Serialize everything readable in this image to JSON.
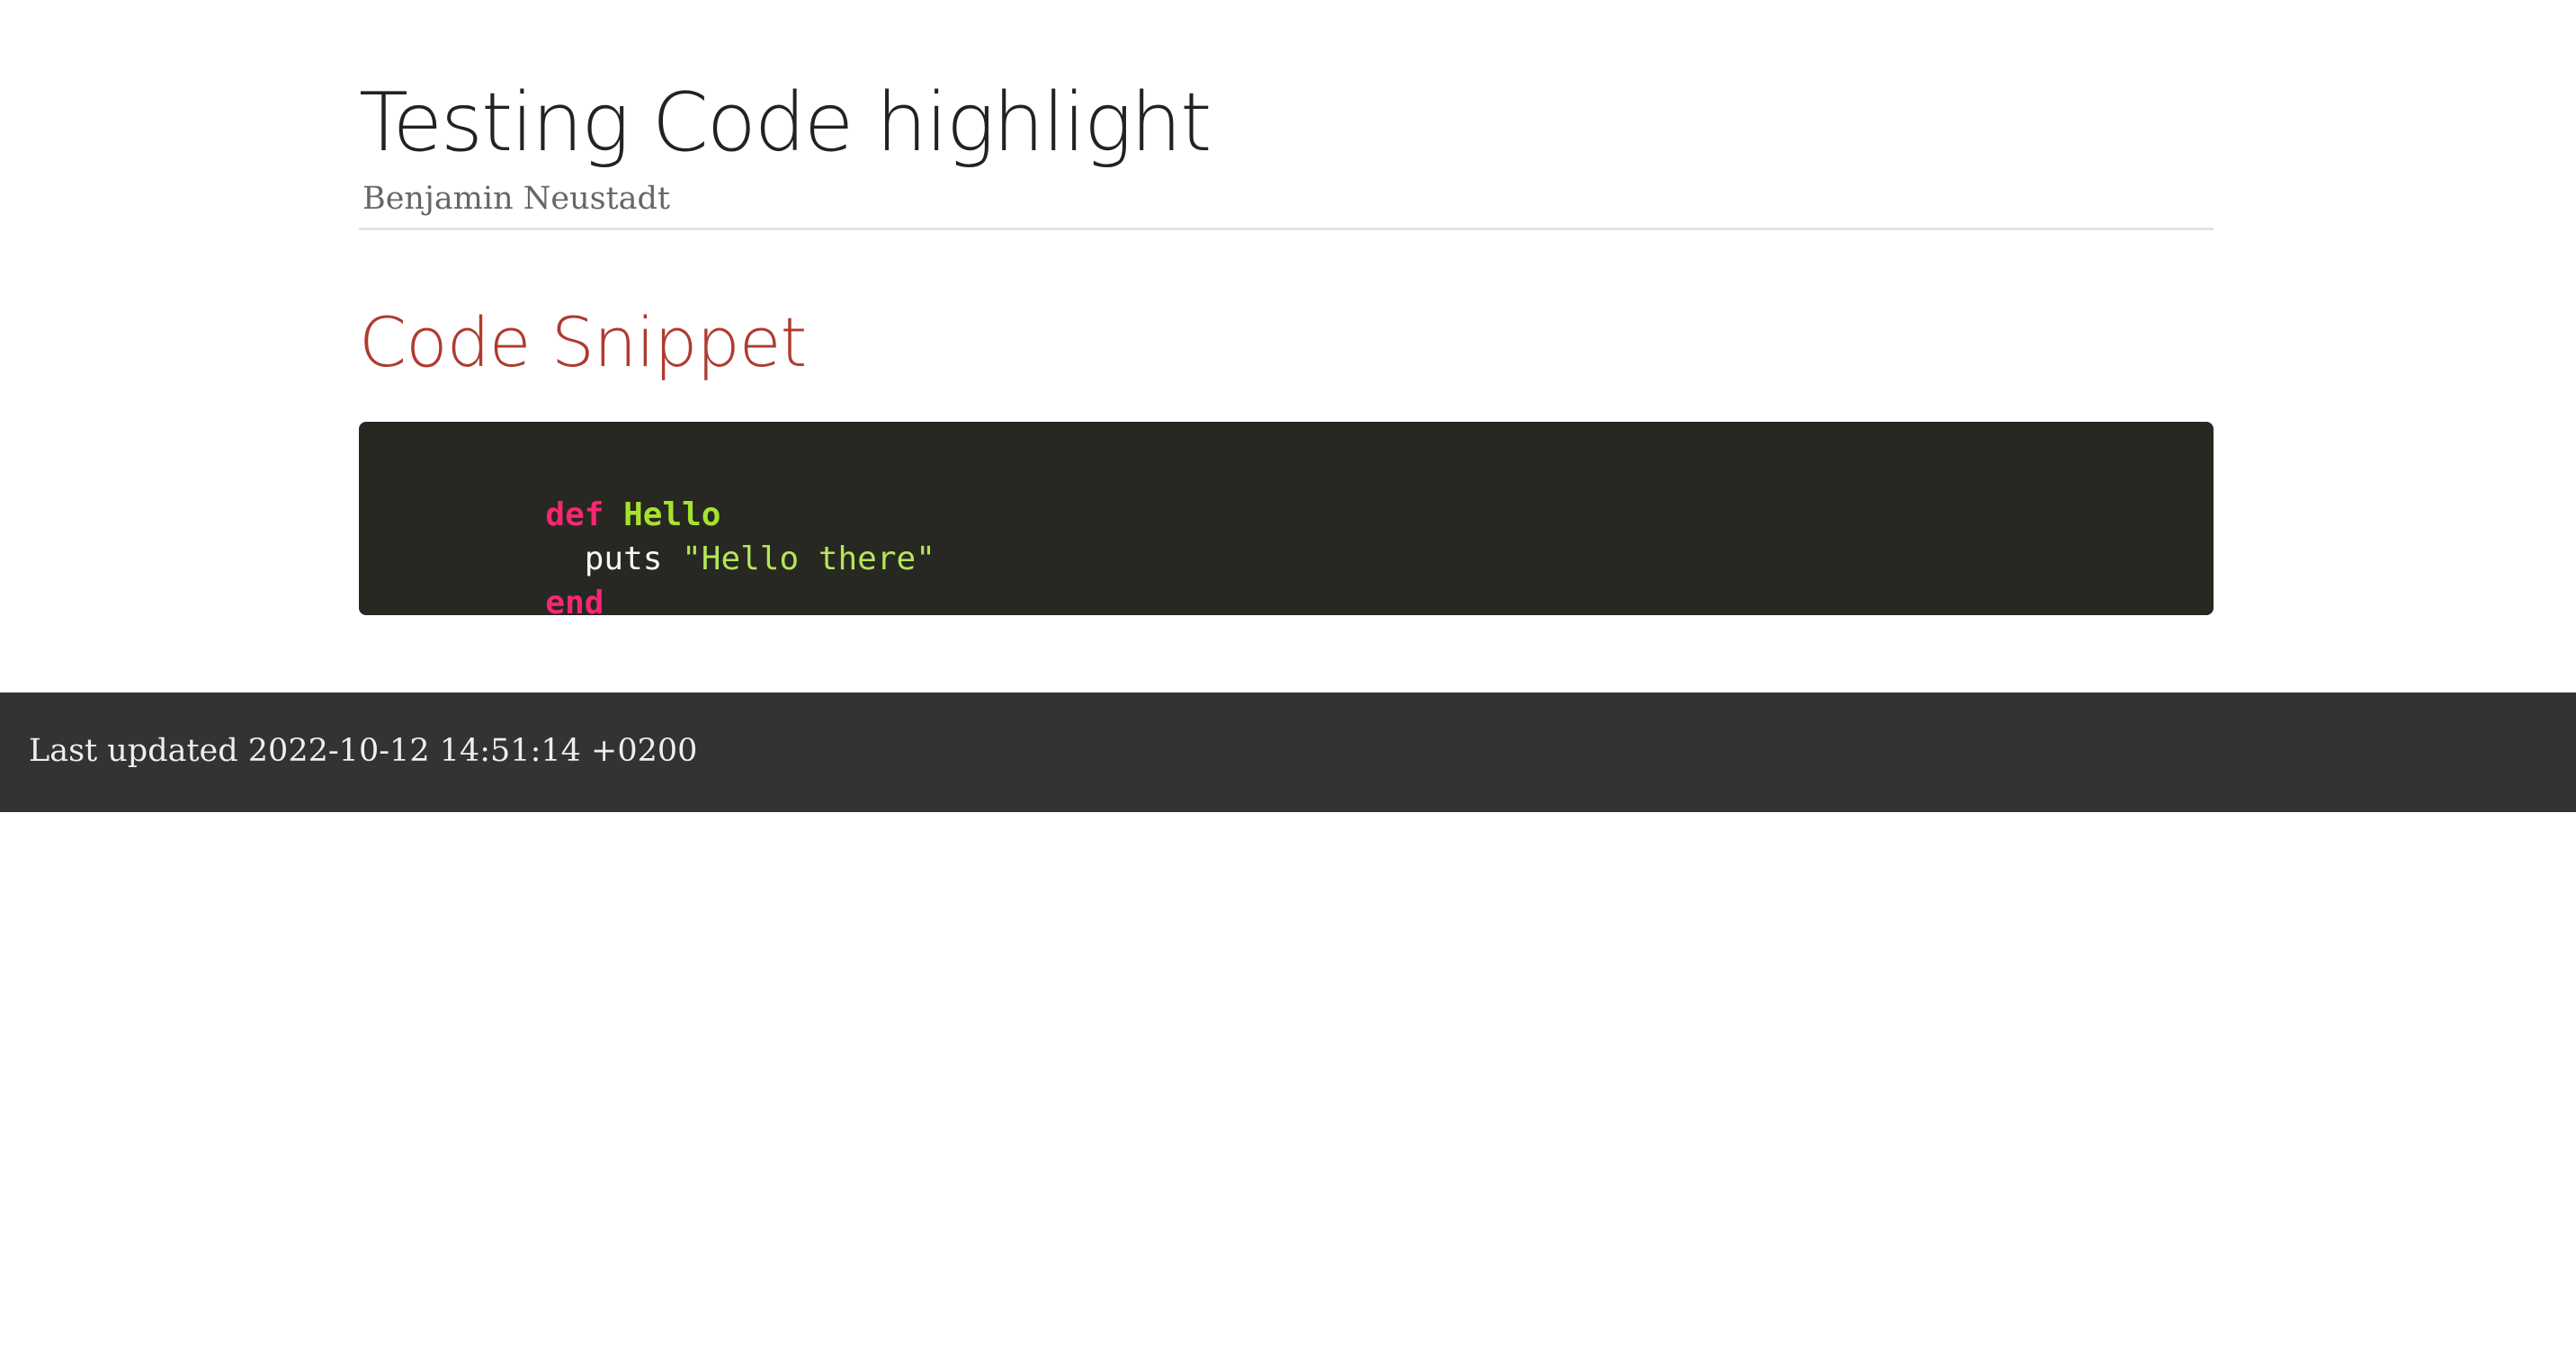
{
  "header": {
    "title": "Testing Code highlight",
    "author": "Benjamin Neustadt"
  },
  "main": {
    "section_heading": "Code Snippet",
    "code": {
      "language": "ruby",
      "theme_colors": {
        "background": "#272822",
        "keyword": "#f92672",
        "function": "#a6e22e",
        "string": "#e6db74",
        "plain": "#f8f8f2"
      },
      "lines": [
        {
          "tokens": [
            {
              "type": "keyword",
              "text": "def"
            },
            {
              "type": "plain",
              "text": " "
            },
            {
              "type": "func",
              "text": "Hello"
            }
          ]
        },
        {
          "tokens": [
            {
              "type": "plain",
              "text": "  puts "
            },
            {
              "type": "string",
              "text": "\"Hello there\""
            }
          ]
        },
        {
          "tokens": [
            {
              "type": "keyword",
              "text": "end"
            }
          ]
        }
      ]
    }
  },
  "footer": {
    "last_updated": "Last updated 2022-10-12 14:51:14 +0200"
  },
  "colors": {
    "heading_accent": "#b03a2e",
    "footer_background": "#333333"
  }
}
